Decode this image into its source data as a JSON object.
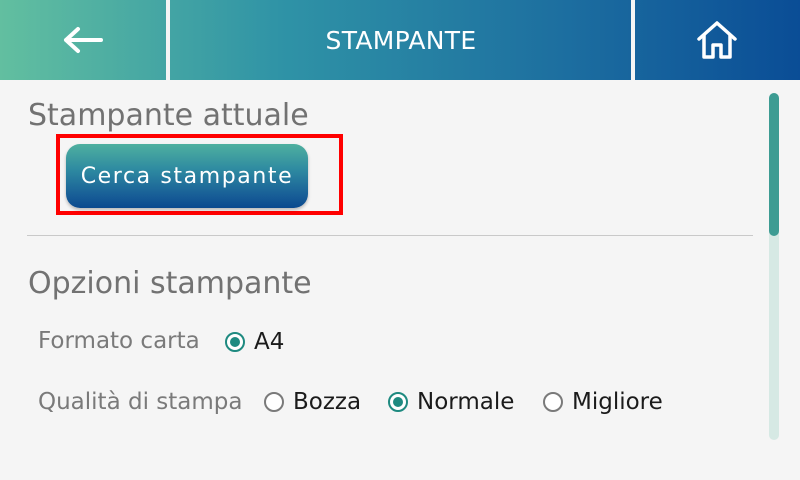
{
  "header": {
    "title": "STAMPANTE",
    "back_icon": "arrow-left-icon",
    "home_icon": "home-icon"
  },
  "current_printer": {
    "title": "Stampante attuale",
    "search_button": "Cerca stampante"
  },
  "options": {
    "title": "Opzioni stampante",
    "paper_format": {
      "label": "Formato carta",
      "options": [
        {
          "label": "A4",
          "selected": true
        }
      ]
    },
    "print_quality": {
      "label": "Qualità di stampa",
      "options": [
        {
          "label": "Bozza",
          "selected": false
        },
        {
          "label": "Normale",
          "selected": true
        },
        {
          "label": "Migliore",
          "selected": false
        }
      ]
    }
  },
  "colors": {
    "accent": "#1e8a80",
    "highlight_border": "#ff0000"
  }
}
